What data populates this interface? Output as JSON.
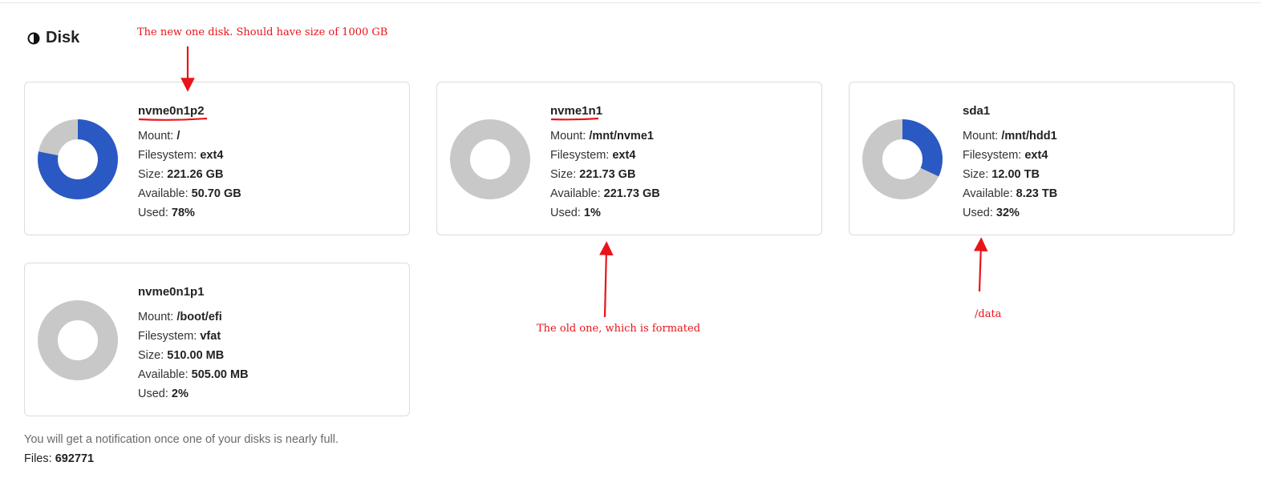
{
  "section": {
    "title": "Disk",
    "icon": "half-circle-icon"
  },
  "labels": {
    "mount": "Mount:",
    "filesystem": "Filesystem:",
    "size": "Size:",
    "available": "Available:",
    "used": "Used:"
  },
  "colors": {
    "used": "#2b59c3",
    "free": "#c8c8c8",
    "annotation": "#e8141a"
  },
  "disks": [
    {
      "name": "nvme0n1p2",
      "mount": "/",
      "filesystem": "ext4",
      "size": "221.26 GB",
      "available": "50.70 GB",
      "used": "78%",
      "used_fraction": 0.78
    },
    {
      "name": "nvme1n1",
      "mount": "/mnt/nvme1",
      "filesystem": "ext4",
      "size": "221.73 GB",
      "available": "221.73 GB",
      "used": "1%",
      "used_fraction": 0.0
    },
    {
      "name": "sda1",
      "mount": "/mnt/hdd1",
      "filesystem": "ext4",
      "size": "12.00 TB",
      "available": "8.23 TB",
      "used": "32%",
      "used_fraction": 0.32
    },
    {
      "name": "nvme0n1p1",
      "mount": "/boot/efi",
      "filesystem": "vfat",
      "size": "510.00 MB",
      "available": "505.00 MB",
      "used": "2%",
      "used_fraction": 0.0
    }
  ],
  "footer": {
    "notice": "You will get a notification once one of your disks is nearly full.",
    "files_label": "Files:",
    "files_value": "692771"
  },
  "annotations": {
    "new_disk": "The new one disk. Should have size of 1000 GB",
    "old_disk": "The old one, which is formated",
    "data": "/data"
  }
}
